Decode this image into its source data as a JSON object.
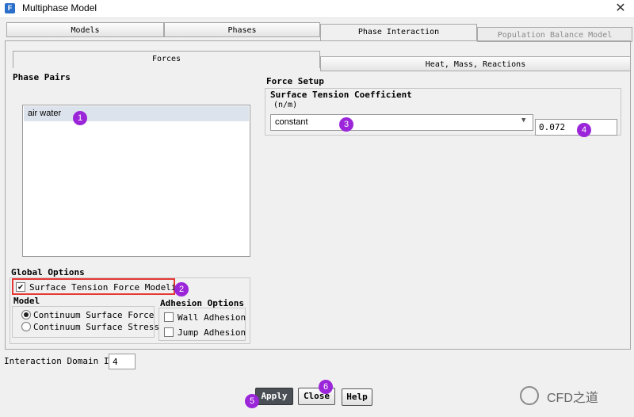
{
  "window": {
    "title": "Multiphase Model",
    "app_icon": "F"
  },
  "tabs": [
    "Models",
    "Phases",
    "Phase Interaction",
    "Population Balance Model"
  ],
  "subtabs": [
    "Forces",
    "Heat, Mass, Reactions"
  ],
  "phase_pairs": {
    "label": "Phase Pairs",
    "items": [
      "air water"
    ]
  },
  "force_setup": {
    "label": "Force Setup",
    "stc_label": "Surface Tension Coefficient",
    "unit": "(n/m)",
    "method": "constant",
    "value": "0.072"
  },
  "global_options": {
    "label": "Global Options",
    "surface_tension_label": "Surface Tension Force Modeling",
    "surface_tension_checked": true,
    "model_label": "Model",
    "model_options": [
      "Continuum Surface Force",
      "Continuum Surface Stress"
    ],
    "adhesion_label": "Adhesion Options",
    "adhesion_options": [
      "Wall Adhesion",
      "Jump Adhesion"
    ]
  },
  "interaction_domain": {
    "label": "Interaction Domain ID",
    "value": "4"
  },
  "buttons": {
    "apply": "Apply",
    "close": "Close",
    "help": "Help"
  },
  "badges": [
    "1",
    "2",
    "3",
    "4",
    "5",
    "6"
  ],
  "watermark": "CFD之道",
  "colors": {
    "badge": "#9b26d9",
    "highlight": "#e53935",
    "primary_button": "#4a4f55"
  }
}
